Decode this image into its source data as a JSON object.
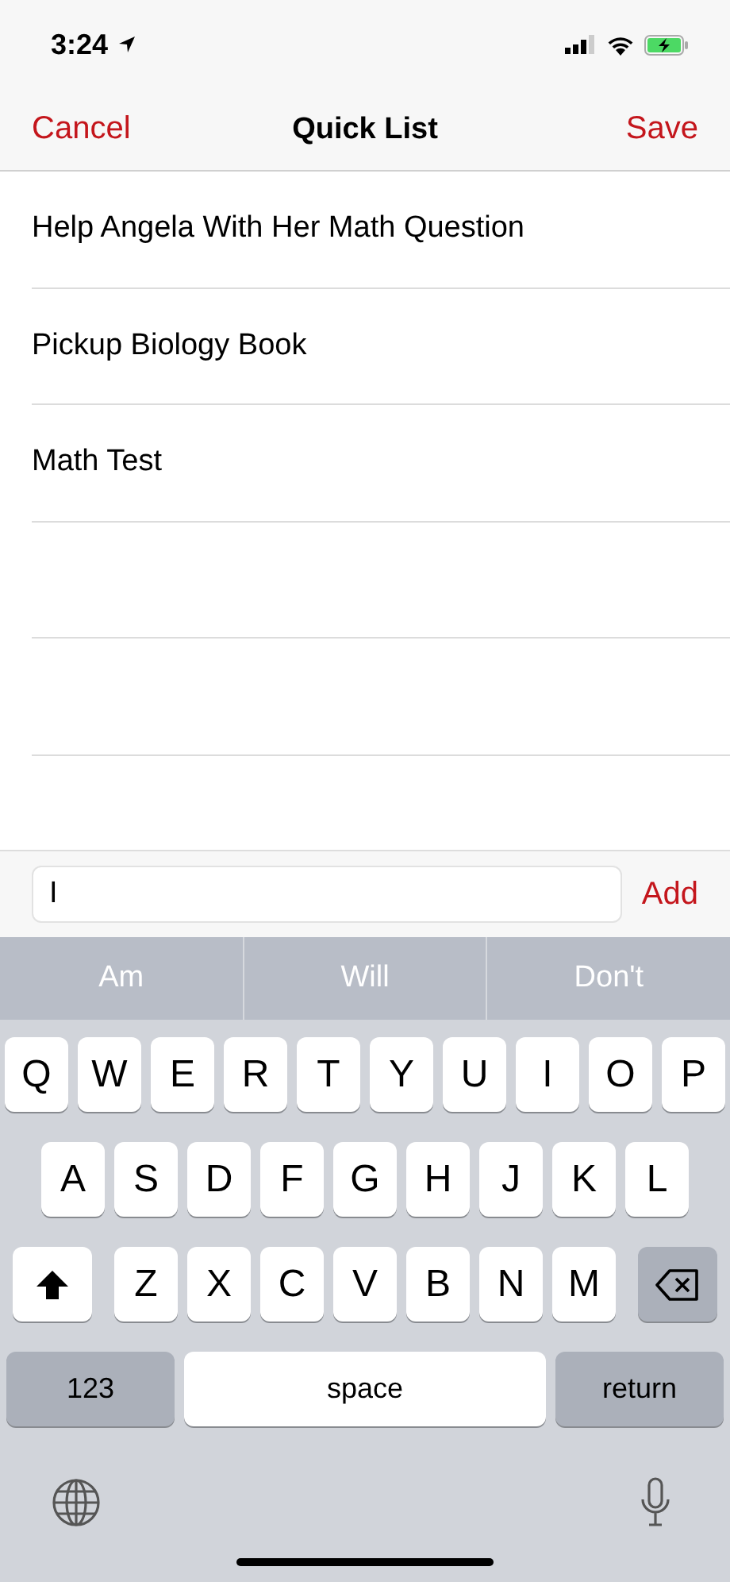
{
  "status_bar": {
    "time": "3:24"
  },
  "nav": {
    "left": "Cancel",
    "title": "Quick List",
    "right": "Save"
  },
  "items": [
    {
      "text": "Help Angela With Her Math Question"
    },
    {
      "text": "Pickup Biology Book"
    },
    {
      "text": "Math Test"
    }
  ],
  "input": {
    "value": "I",
    "button": "Add"
  },
  "suggestions": [
    "Am",
    "Will",
    "Don't"
  ],
  "keyboard": {
    "rows": [
      {
        "keys": [
          {
            "kind": "letter",
            "label": "Q"
          },
          {
            "kind": "letter",
            "label": "W"
          },
          {
            "kind": "letter",
            "label": "E"
          },
          {
            "kind": "letter",
            "label": "R"
          },
          {
            "kind": "letter",
            "label": "T"
          },
          {
            "kind": "letter",
            "label": "Y"
          },
          {
            "kind": "letter",
            "label": "U"
          },
          {
            "kind": "letter",
            "label": "I"
          },
          {
            "kind": "letter",
            "label": "O"
          },
          {
            "kind": "letter",
            "label": "P"
          }
        ]
      },
      {
        "keys": [
          {
            "kind": "letter",
            "label": "A"
          },
          {
            "kind": "letter",
            "label": "S"
          },
          {
            "kind": "letter",
            "label": "D"
          },
          {
            "kind": "letter",
            "label": "F"
          },
          {
            "kind": "letter",
            "label": "G"
          },
          {
            "kind": "letter",
            "label": "H"
          },
          {
            "kind": "letter",
            "label": "J"
          },
          {
            "kind": "letter",
            "label": "K"
          },
          {
            "kind": "letter",
            "label": "L"
          }
        ]
      },
      {
        "keys": [
          {
            "kind": "shift"
          },
          {
            "kind": "letter",
            "label": "Z"
          },
          {
            "kind": "letter",
            "label": "X"
          },
          {
            "kind": "letter",
            "label": "C"
          },
          {
            "kind": "letter",
            "label": "V"
          },
          {
            "kind": "letter",
            "label": "B"
          },
          {
            "kind": "letter",
            "label": "N"
          },
          {
            "kind": "letter",
            "label": "M"
          },
          {
            "kind": "delete"
          }
        ]
      },
      {
        "keys": [
          {
            "kind": "mode",
            "label": "123"
          },
          {
            "kind": "space",
            "label": "space"
          },
          {
            "kind": "return",
            "label": "return"
          }
        ]
      }
    ]
  }
}
